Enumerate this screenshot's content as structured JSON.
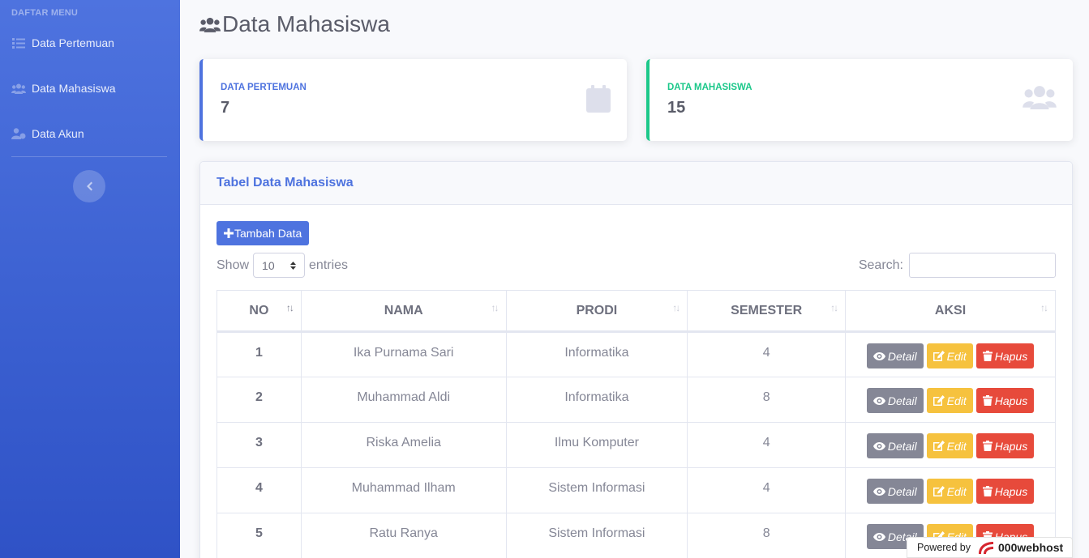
{
  "sidebar": {
    "heading": "DAFTAR MENU",
    "items": [
      {
        "label": "Data Pertemuan",
        "icon": "list-icon"
      },
      {
        "label": "Data Mahasiswa",
        "icon": "users-icon"
      },
      {
        "label": "Data Akun",
        "icon": "user-cog-icon"
      }
    ]
  },
  "page": {
    "title": "Data Mahasiswa"
  },
  "stats": [
    {
      "label": "DATA PERTEMUAN",
      "value": "7",
      "icon": "calendar-icon",
      "color": "#4e73df"
    },
    {
      "label": "DATA MAHASISWA",
      "value": "15",
      "icon": "users-icon",
      "color": "#1cc88a"
    }
  ],
  "table_card": {
    "title": "Tabel Data Mahasiswa",
    "add_button": "Tambah Data",
    "show_label": "Show",
    "entries_value": "10",
    "entries_label": "entries",
    "search_label": "Search:",
    "search_value": "",
    "columns": [
      "NO",
      "NAMA",
      "PRODI",
      "SEMESTER",
      "AKSI"
    ],
    "rows": [
      {
        "no": "1",
        "nama": "Ika Purnama Sari",
        "prodi": "Informatika",
        "semester": "4"
      },
      {
        "no": "2",
        "nama": "Muhammad Aldi",
        "prodi": "Informatika",
        "semester": "8"
      },
      {
        "no": "3",
        "nama": "Riska Amelia",
        "prodi": "Ilmu Komputer",
        "semester": "4"
      },
      {
        "no": "4",
        "nama": "Muhammad Ilham",
        "prodi": "Sistem Informasi",
        "semester": "4"
      },
      {
        "no": "5",
        "nama": "Ratu Ranya",
        "prodi": "Sistem Informasi",
        "semester": "8"
      }
    ],
    "actions": {
      "detail": "Detail",
      "edit": "Edit",
      "hapus": "Hapus"
    }
  },
  "footer": {
    "powered_by": "Powered by",
    "brand": "000webhost"
  },
  "colors": {
    "primary": "#4e73df",
    "success": "#1cc88a",
    "warning": "#f6c23e",
    "danger": "#e74a3b",
    "secondary": "#858796"
  }
}
